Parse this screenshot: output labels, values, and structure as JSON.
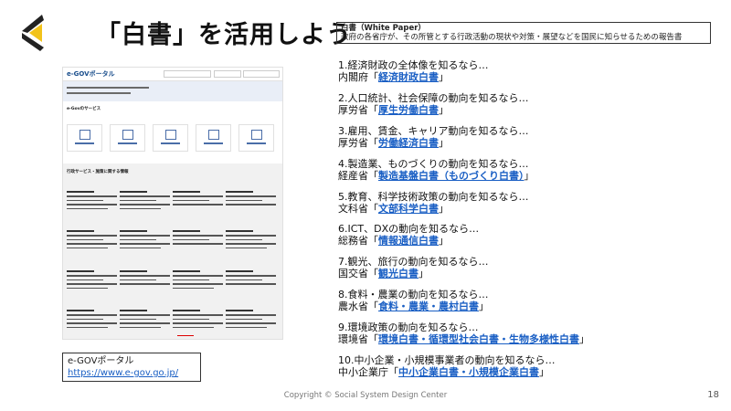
{
  "title": "「白書」を活用しよう",
  "definition": {
    "heading": "白書（White Paper）",
    "body": "政府の各省庁が、その所管とする行政活動の現状や対策・展望などを国民に知らせるための報告書"
  },
  "screenshot": {
    "brand": "e-GOVポータル",
    "section1": "e-Govのサービス",
    "section2": "行政サービス・施策に関する情報"
  },
  "portal": {
    "label": "e-GOVポータル",
    "url": "https://www.e-gov.go.jp/"
  },
  "items": [
    {
      "line1": "1.経済財政の全体像を知るなら…",
      "prefix": "内閣府「",
      "link": "経済財政白書",
      "suffix": "」"
    },
    {
      "line1": "2.人口統計、社会保障の動向を知るなら…",
      "prefix": "厚労省「",
      "link": "厚生労働白書",
      "suffix": "」"
    },
    {
      "line1": "3.雇用、賃金、キャリア動向を知るなら…",
      "prefix": "厚労省「",
      "link": "労働経済白書",
      "suffix": "」"
    },
    {
      "line1": "4.製造業、ものづくりの動向を知るなら…",
      "prefix": "経産省「",
      "link": "製造基盤白書（ものづくり白書）",
      "suffix": "」"
    },
    {
      "line1": "5.教育、科学技術政策の動向を知るなら…",
      "prefix": "文科省「",
      "link": "文部科学白書",
      "suffix": "」"
    },
    {
      "line1": "6.ICT、DXの動向を知るなら…",
      "prefix": "総務省「",
      "link": "情報通信白書",
      "suffix": "」"
    },
    {
      "line1": "7.観光、旅行の動向を知るなら…",
      "prefix": "国交省「",
      "link": "観光白書",
      "suffix": "」"
    },
    {
      "line1": "8.食料・農業の動向を知るなら…",
      "prefix": "農水省「",
      "link": "食料・農業・農村白書",
      "suffix": "」"
    },
    {
      "line1": "9.環境政策の動向を知るなら…",
      "prefix": "環境省「",
      "link": "環境白書・循環型社会白書・生物多様性白書",
      "suffix": "」"
    },
    {
      "line1": "10.中小企業・小規模事業者の動向を知るなら…",
      "prefix": "中小企業庁「",
      "link": "中小企業白書・小規模企業白書",
      "suffix": "」"
    }
  ],
  "footer": "Copyright © Social System Design Center",
  "page_number": "18"
}
